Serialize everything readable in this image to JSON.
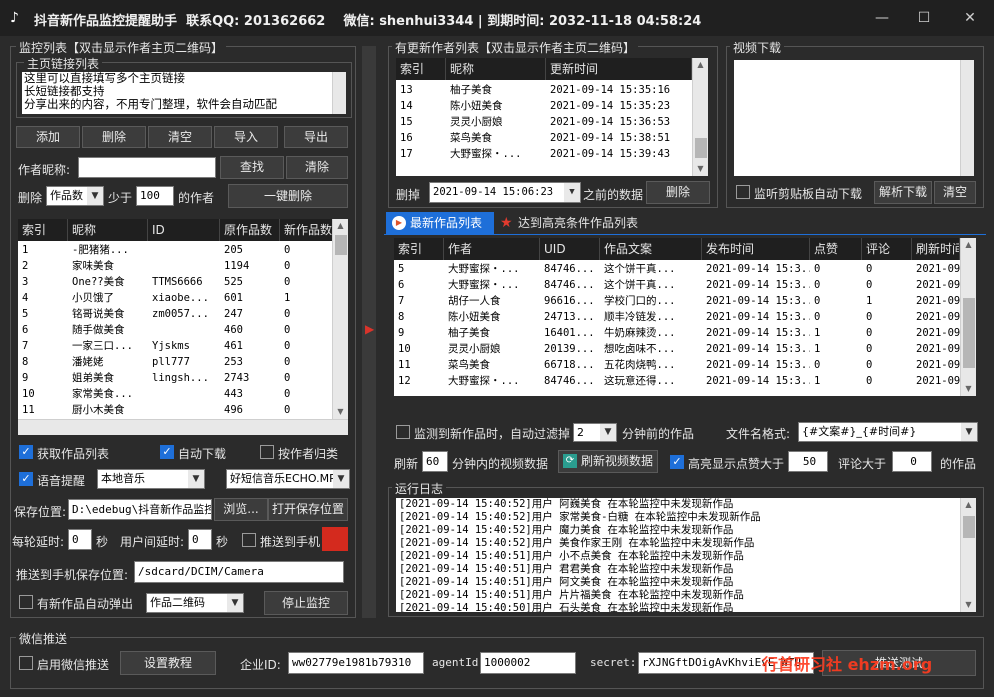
{
  "title": {
    "app": "抖音新作品监控提醒助手",
    "qq_label": "联系QQ:",
    "qq": "201362662",
    "wx_label": "微信:",
    "wx": "shenhui3344",
    "expiry_label": "到期时间:",
    "expiry": "2032-11-18 04:58:24"
  },
  "monitor": {
    "group_title": "监控列表【双击显示作者主页二维码】",
    "links_title": "主页链接列表",
    "links_text": [
      "这里可以直接填写多个主页链接",
      "长短链接都支持",
      "分享出来的内容，不用专门整理，软件会自动匹配"
    ],
    "buttons": {
      "add": "添加",
      "delete": "删除",
      "clear": "清空",
      "import": "导入",
      "export": "导出"
    },
    "author_label": "作者昵称:",
    "author_value": "",
    "find": "查找",
    "clear2": "清除",
    "del_label": "删除",
    "del_select": "作品数",
    "less_than": "少于",
    "less_value": "100",
    "of_author": "的作者",
    "one_click_delete": "一键删除",
    "columns": [
      "索引",
      "昵称",
      "ID",
      "原作品数",
      "新作品数"
    ],
    "rows": [
      [
        "1",
        "-肥猪猪...",
        "",
        "205",
        "0"
      ],
      [
        "2",
        "家味美食",
        "",
        "1194",
        "0"
      ],
      [
        "3",
        "One??美食",
        "TTMS6666",
        "525",
        "0"
      ],
      [
        "4",
        "小贝饿了",
        "xiaobe...",
        "601",
        "1"
      ],
      [
        "5",
        "铭哥说美食",
        "zm0057...",
        "247",
        "0"
      ],
      [
        "6",
        "随手做美食",
        "",
        "460",
        "0"
      ],
      [
        "7",
        "一家三口...",
        "Yjskms",
        "461",
        "0"
      ],
      [
        "8",
        "潘姥姥",
        "pll777",
        "253",
        "0"
      ],
      [
        "9",
        "姐弟美食",
        "lingsh...",
        "2743",
        "0"
      ],
      [
        "10",
        "家常美食...",
        "",
        "443",
        "0"
      ],
      [
        "11",
        "厨小木美食",
        "",
        "496",
        "0"
      ]
    ],
    "get_works": "获取作品列表",
    "auto_download": "自动下载",
    "by_author": "按作者归类",
    "voice": "语音提醒",
    "music_select": "本地音乐",
    "music_file": "好短信音乐ECHO.MP3",
    "save_label": "保存位置:",
    "save_path": "D:\\edebug\\抖音新作品监控",
    "browse": "浏览...",
    "open_save": "打开保存位置",
    "poll_delay_label": "每轮延时:",
    "poll_delay": "0",
    "sec": "秒",
    "user_delay_label": "用户间延时:",
    "user_delay": "0",
    "sec2": "秒",
    "push_phone": "推送到手机",
    "phone_path_label": "推送到手机保存位置:",
    "phone_path": "/sdcard/DCIM/Camera",
    "popup": "有新作品自动弹出",
    "popup_select": "作品二维码",
    "stop": "停止监控"
  },
  "updated": {
    "group_title": "有更新作者列表【双击显示作者主页二维码】",
    "columns": [
      "索引",
      "昵称",
      "更新时间"
    ],
    "rows": [
      [
        "13",
        "柚子美食",
        "2021-09-14  15:35:16"
      ],
      [
        "14",
        "陈小妞美食",
        "2021-09-14  15:35:23"
      ],
      [
        "15",
        "灵灵小厨娘",
        "2021-09-14  15:36:53"
      ],
      [
        "16",
        "菜鸟美食",
        "2021-09-14  15:38:51"
      ],
      [
        "17",
        "大野蜜探・...",
        "2021-09-14  15:39:43"
      ]
    ],
    "del_label": "删掉",
    "del_time": "2021-09-14 15:06:23",
    "before": "之前的数据",
    "delete": "删除"
  },
  "video": {
    "group_title": "视频下载",
    "clipboard": "监听剪贴板自动下载",
    "parse": "解析下载",
    "clear": "清空"
  },
  "works": {
    "tab1": "最新作品列表",
    "tab2": "达到高亮条件作品列表",
    "columns": [
      "索引",
      "作者",
      "UID",
      "作品文案",
      "发布时间",
      "点赞",
      "评论",
      "刷新时间"
    ],
    "rows": [
      [
        "5",
        "大野蜜探・...",
        "84746...",
        "这个饼干真...",
        "2021-09-14  15:3...",
        "0",
        "0",
        "2021-09"
      ],
      [
        "6",
        "大野蜜探・...",
        "84746...",
        "这个饼干真...",
        "2021-09-14  15:3...",
        "0",
        "0",
        "2021-09"
      ],
      [
        "7",
        "胡仔一人食",
        "96616...",
        "学校门口的...",
        "2021-09-14  15:3...",
        "0",
        "1",
        "2021-09"
      ],
      [
        "8",
        "陈小妞美食",
        "24713...",
        "顺丰冷链发...",
        "2021-09-14  15:3...",
        "0",
        "0",
        "2021-09"
      ],
      [
        "9",
        "柚子美食",
        "16401...",
        "牛奶麻辣烫...",
        "2021-09-14  15:3...",
        "1",
        "0",
        "2021-09"
      ],
      [
        "10",
        "灵灵小厨娘",
        "20139...",
        "想吃卤味不...",
        "2021-09-14  15:3...",
        "1",
        "0",
        "2021-09"
      ],
      [
        "11",
        "菜鸟美食",
        "66718...",
        "五花肉烧鸭...",
        "2021-09-14  15:3...",
        "0",
        "0",
        "2021-09"
      ],
      [
        "12",
        "大野蜜探・...",
        "84746...",
        "这玩意还得...",
        "2021-09-14  15:3...",
        "1",
        "0",
        "2021-09"
      ]
    ],
    "filter_label": "监测到新作品时，自动过滤掉",
    "filter_value": "2",
    "filter_suffix": "分钟前的作品",
    "filename_label": "文件名格式:",
    "filename_value": "{#文案#}_{#时间#}",
    "refresh_label": "刷新",
    "refresh_value": "60",
    "refresh_suffix": "分钟内的视频数据",
    "refresh_btn": "刷新视频数据",
    "highlight": "高亮显示点赞大于",
    "like_value": "50",
    "comment_label": "评论大于",
    "comment_value": "0",
    "of_works": "的作品"
  },
  "log": {
    "group_title": "运行日志",
    "lines": [
      "[2021-09-14 15:40:52]用户 阿巍美食 在本轮监控中未发现新作品",
      "[2021-09-14 15:40:52]用户 家常美食-白糖 在本轮监控中未发现新作品",
      "[2021-09-14 15:40:52]用户 魔力美食 在本轮监控中未发现新作品",
      "[2021-09-14 15:40:52]用户 美食作家王刚 在本轮监控中未发现新作品",
      "[2021-09-14 15:40:51]用户 小不点美食 在本轮监控中未发现新作品",
      "[2021-09-14 15:40:51]用户 君君美食 在本轮监控中未发现新作品",
      "[2021-09-14 15:40:51]用户 阿文美食 在本轮监控中未发现新作品",
      "[2021-09-14 15:40:51]用户 片片福美食 在本轮监控中未发现新作品",
      "[2021-09-14 15:40:50]用户 石头美食 在本轮监控中未发现新作品"
    ]
  },
  "wechat": {
    "group_title": "微信推送",
    "enable": "启用微信推送",
    "tutorial": "设置教程",
    "corp_label": "企业ID:",
    "corp_value": "ww02779e1981b79310",
    "agent_label": "agentId:",
    "agent_value": "1000002",
    "secret_label": "secret:",
    "secret_value": "rXJNGftDOigAvKhviEvE_WTU",
    "push_btn": "推送测试",
    "watermark": "行首研习社 ehzm.org"
  },
  "colors": {
    "accent": "#1e6fd9",
    "red_box": "#d42a1e",
    "star": "#e23b2e",
    "watermark": "#ff3b1f"
  }
}
